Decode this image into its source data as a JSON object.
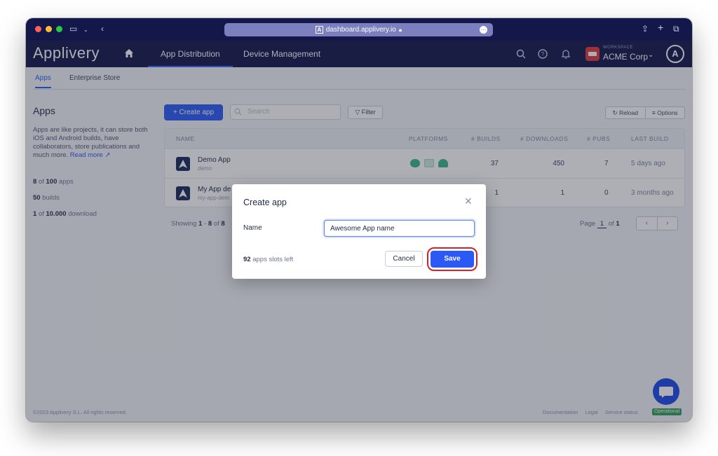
{
  "browser": {
    "url": "dashboard.applivery.io"
  },
  "header": {
    "logo": "Applivery",
    "tabs": [
      {
        "label": "App Distribution",
        "active": true
      },
      {
        "label": "Device Management",
        "active": false
      }
    ],
    "workspace_caption": "WORKSPACE",
    "workspace_name": "ACME Corp",
    "workspace_color": "#e0363c"
  },
  "subtabs": [
    {
      "label": "Apps",
      "active": true
    },
    {
      "label": "Enterprise Store",
      "active": false
    }
  ],
  "sidebar": {
    "title": "Apps",
    "description": "Apps are like projects, it can store both iOS and Android builds, have collaborators, store publications and much more.",
    "read_more": "Read more",
    "stats": [
      {
        "value": "8",
        "of": "of",
        "total": "100",
        "unit": "apps"
      },
      {
        "value": "50",
        "unit": "builds"
      },
      {
        "value": "1",
        "of": "of",
        "total": "10.000",
        "unit": "download"
      }
    ]
  },
  "toolbar": {
    "create_label": "+ Create app",
    "search_placeholder": "Search",
    "filter_label": "Filter",
    "reload_label": "Reload",
    "options_label": "Options"
  },
  "table": {
    "columns": [
      "NAME",
      "PLATFORMS",
      "# BUILDS",
      "# DOWNLOADS",
      "# PUBS",
      "LAST BUILD"
    ],
    "rows": [
      {
        "name": "Demo App",
        "slug": "demo",
        "builds": "37",
        "downloads": "450",
        "pubs": "7",
        "last_build": "5 days ago"
      },
      {
        "name": "My App de",
        "slug": "my-app-dem",
        "builds": "1",
        "downloads": "1",
        "pubs": "0",
        "last_build": "3 months ago"
      }
    ]
  },
  "pagination": {
    "showing_prefix": "Showing",
    "range_start": "1",
    "range_end": "8",
    "of": "of",
    "total": "8",
    "page_label": "Page",
    "page": "1",
    "of_label": "of",
    "pages": "1",
    "prev": "‹",
    "next": "›"
  },
  "footer": {
    "copyright": "©2023 Applivery S.L. All rights reserved.",
    "links": [
      "Documentation",
      "Legal",
      "Service status"
    ],
    "status_badge": "Operational"
  },
  "modal": {
    "title": "Create app",
    "close": "✕",
    "name_label": "Name",
    "name_value": "Awesome App name",
    "slots_count": "92",
    "slots_text": "apps slots left",
    "cancel_label": "Cancel",
    "save_label": "Save",
    "highlight_color": "#d8202a"
  },
  "colors": {
    "primary": "#2b59f5",
    "header_bg": "#111449",
    "operational": "#2f9e5a"
  }
}
